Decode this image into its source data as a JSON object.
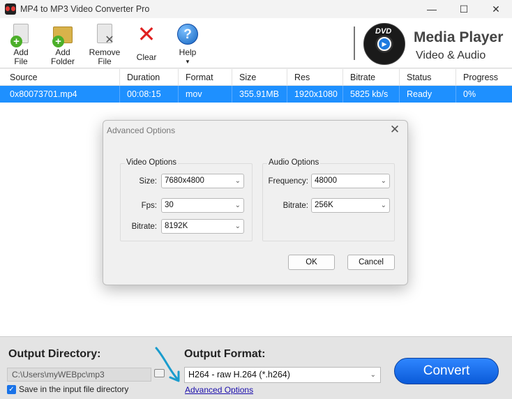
{
  "window": {
    "title": "MP4 to MP3 Video Converter Pro",
    "minimize": "—",
    "maximize": "☐",
    "close": "✕"
  },
  "toolbar": {
    "add_file": [
      "Add",
      "File"
    ],
    "add_folder": [
      "Add",
      "Folder"
    ],
    "remove_file": [
      "Remove",
      "File"
    ],
    "clear": "Clear",
    "help": "Help",
    "help_caret": "▼"
  },
  "brand": {
    "title": "Media Player",
    "subtitle": "Video & Audio",
    "badge": "DVD"
  },
  "table": {
    "columns": [
      "Source",
      "Duration",
      "Format",
      "Size",
      "Res",
      "Bitrate",
      "Status",
      "Progress"
    ],
    "rows": [
      [
        "0x80073701.mp4",
        "00:08:15",
        "mov",
        "355.91MB",
        "1920x1080",
        "5825 kb/s",
        "Ready",
        "0%"
      ]
    ]
  },
  "dialog": {
    "title": "Advanced Options",
    "close": "✕",
    "video_group": "Video Options",
    "audio_group": "Audio Options",
    "size_label": "Size:",
    "size_value": "7680x4800",
    "fps_label": "Fps:",
    "fps_value": "30",
    "vbitrate_label": "Bitrate:",
    "vbitrate_value": "8192K",
    "freq_label": "Frequency:",
    "freq_value": "48000",
    "abitrate_label": "Bitrate:",
    "abitrate_value": "256K",
    "ok": "OK",
    "cancel": "Cancel"
  },
  "bottom": {
    "output_dir_label": "Output Directory:",
    "output_dir_value": "C:\\Users\\myWEBpc\\mp3",
    "save_in_input": "Save in the input file directory",
    "output_format_label": "Output Format:",
    "output_format_value": "H264 - raw H.264 (*.h264)",
    "advanced_link": "Advanced Options",
    "convert": "Convert"
  },
  "colors": {
    "selection": "#1e90ff",
    "convert": "#1f7be0",
    "annotation_arrow": "#1a9ccd"
  }
}
